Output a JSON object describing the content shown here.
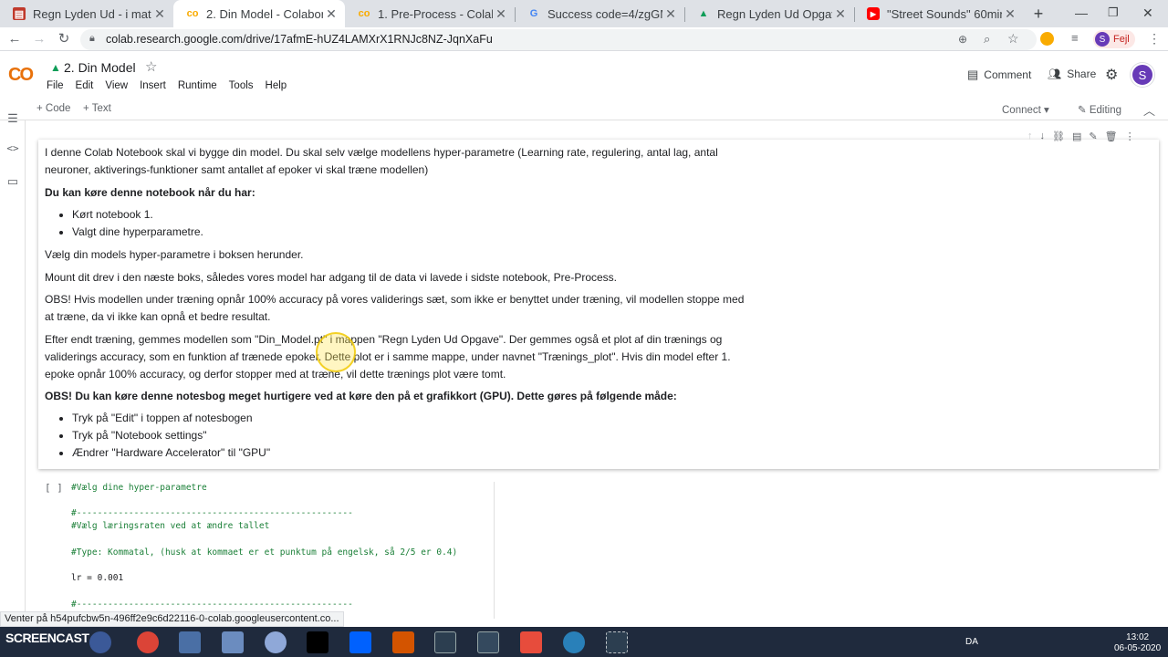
{
  "browser": {
    "tabs": [
      {
        "title": "Regn Lyden Ud - i mate",
        "icon": "slides-icon",
        "color": "#c0392b"
      },
      {
        "title": "2. Din Model - Colabora",
        "icon": "colab-icon",
        "color": "#f9ab00"
      },
      {
        "title": "1. Pre-Process - Colabo",
        "icon": "colab-icon",
        "color": "#f9ab00"
      },
      {
        "title": "Success code=4/zgGMr",
        "icon": "google-icon",
        "color": "#4285f4"
      },
      {
        "title": "Regn Lyden Ud Opgave",
        "icon": "drive-icon",
        "color": "#0f9d58"
      },
      {
        "title": "\"Street Sounds\" 60min",
        "icon": "youtube-icon",
        "color": "#ff0000"
      }
    ],
    "url": "colab.research.google.com/drive/17afmE-hUZ4LAMXrX1RNJc8NZ-JqnXaFu",
    "profile_initial": "S",
    "profile_status": "Fejl"
  },
  "colab": {
    "logo": "CO",
    "notebook_title": "2. Din Model",
    "menu": [
      "File",
      "Edit",
      "View",
      "Insert",
      "Runtime",
      "Tools",
      "Help"
    ],
    "comment_label": "Comment",
    "share_label": "Share",
    "avatar_initial": "S",
    "add_code": "+ Code",
    "add_text": "+ Text",
    "connect_label": "Connect",
    "editing_label": "Editing"
  },
  "text_cell": {
    "intro": "I denne Colab Notebook skal vi bygge din model. Du skal selv vælge modellens hyper-parametre (Learning rate, regulering, antal lag, antal neuroner, aktiverings-funktioner samt antallet af epoker vi skal træne modellen)",
    "when_heading": "Du kan køre denne notebook når du har:",
    "when_items": [
      "Kørt notebook 1.",
      "Valgt dine hyperparametre."
    ],
    "choose": "Vælg din models hyper-parametre i boksen herunder.",
    "mount": "Mount dit drev i den næste boks, således vores model har adgang til de data vi lavede i sidste notebook, Pre-Process.",
    "obs1": "OBS! Hvis modellen under træning opnår 100% accuracy på vores validerings sæt, som ikke er benyttet under træning, vil modellen stoppe med at træne, da vi ikke kan opnå et bedre resultat.",
    "after": "Efter endt træning, gemmes modellen som \"Din_Model.pt\" i mappen \"Regn Lyden Ud Opgave\". Der gemmes også et plot af din trænings og validerings accuracy, som en funktion af trænede epoker. Dette plot er i samme mappe, under navnet \"Trænings_plot\". Hvis din model efter 1. epoke opnår 100% accuracy, og derfor stopper med at træne, vil dette trænings plot være tomt.",
    "gpu_heading": "OBS! Du kan køre denne notesbog meget hurtigere ved at køre den på et grafikkort (GPU). Dette gøres på følgende måde:",
    "gpu_items": [
      "Tryk på \"Edit\" i toppen af notesbogen",
      "Tryk på \"Notebook settings\"",
      "Ændrer \"Hardware Accelerator\" til \"GPU\""
    ]
  },
  "code_cell": {
    "run_bracket": "[ ]",
    "lines": [
      "#Vælg dine hyper-parametre",
      "#-----------------------------------------------------",
      "#Vælg læringsraten ved at ændre tallet",
      "#Type: Kommatal, (husk at kommaet er et punktum på engelsk, så 2/5 er 0.4)",
      "lr = 0.001",
      "#-----------------------------------------------------"
    ]
  },
  "status_link": "Venter på h54pufcbw5n-496ff2e9c6d22116-0-colab.googleusercontent.co...",
  "taskbar": {
    "watermark": "SCREENCAST",
    "lang": "DA",
    "time": "13:02",
    "date": "06-05-2020"
  }
}
